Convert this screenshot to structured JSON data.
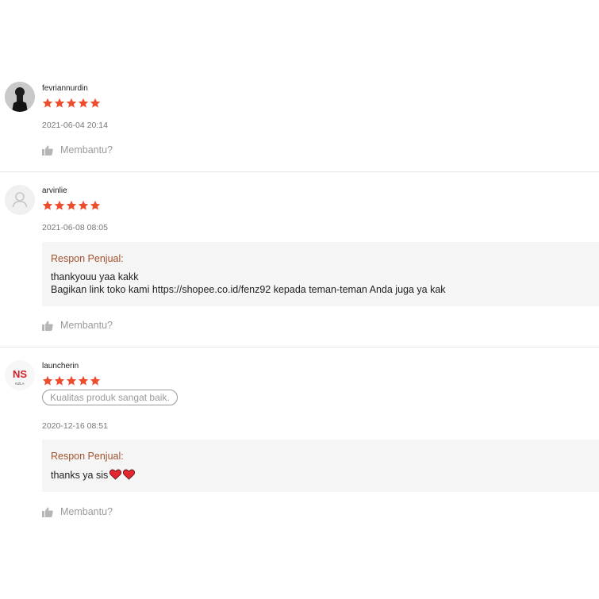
{
  "reviews": [
    {
      "username": "fevriannurdin",
      "rating": 5,
      "timestamp": "2021-06-04 20:14",
      "helpful_label": "Membantu?"
    },
    {
      "username": "arvinlie",
      "rating": 5,
      "timestamp": "2021-06-08 08:05",
      "seller_response": {
        "title": "Respon Penjual:",
        "line1": "thankyouu yaa kakk",
        "line2": "Bagikan link toko kami https://shopee.co.id/fenz92 kepada teman-teman Anda juga ya kak"
      },
      "helpful_label": "Membantu?"
    },
    {
      "username": "launcherin",
      "rating": 5,
      "tag": "Kualitas produk sangat baik.",
      "timestamp": "2020-12-16 08:51",
      "avatar_logo": {
        "text": "NS",
        "subtext": "NZLA"
      },
      "seller_response": {
        "title": "Respon Penjual:",
        "text": "thanks ya sis"
      },
      "helpful_label": "Membantu?"
    }
  ],
  "icons": {
    "star": "star-icon",
    "thumb": "thumbs-up-icon",
    "heart": "heart-icon",
    "avatar_placeholder": "user-placeholder-icon"
  },
  "colors": {
    "star": "#ee4d2d",
    "seller_title": "#a0522d",
    "heart": "#e3262f",
    "muted": "#9a9a9a"
  }
}
